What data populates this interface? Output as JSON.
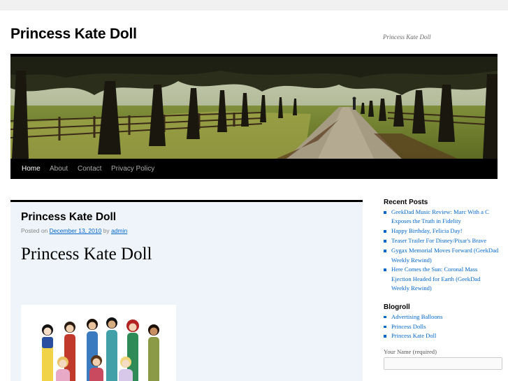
{
  "site": {
    "title": "Princess Kate Doll",
    "description": "Princess Kate Doll"
  },
  "nav": {
    "items": [
      {
        "label": "Home",
        "active": true
      },
      {
        "label": "About",
        "active": false
      },
      {
        "label": "Contact",
        "active": false
      },
      {
        "label": "Privacy Policy",
        "active": false
      }
    ]
  },
  "post": {
    "title": "Princess Kate Doll",
    "meta_prefix": "Posted on",
    "date": "December 13, 2010",
    "meta_by": "by",
    "author": "admin",
    "heading": "Princess Kate Doll"
  },
  "sidebar": {
    "recent_posts_title": "Recent Posts",
    "recent_posts": [
      "GeekDad Music Review: Marc With a C Exposes the Truth in Fidelity",
      "Happy Birthday, Felicia Day!",
      "Teaser Trailer For Disney/Pixar's Brave",
      "Gygax Memorial Moves Forward (GeekDad Weekly Rewind)",
      "Here Comes the Sun: Coronal Mass Ejection Headed for Earth (GeekDad Weekly Rewind)"
    ],
    "blogroll_title": "Blogroll",
    "blogroll": [
      "Advertising Balloons",
      "Princess Dolls",
      "Princess Kate Doll"
    ],
    "name_label": "Your Name (required)",
    "name_value": ""
  },
  "colors": {
    "link": "#0066cc",
    "nav_bg": "#000000",
    "post_bg": "#eef4f9"
  }
}
